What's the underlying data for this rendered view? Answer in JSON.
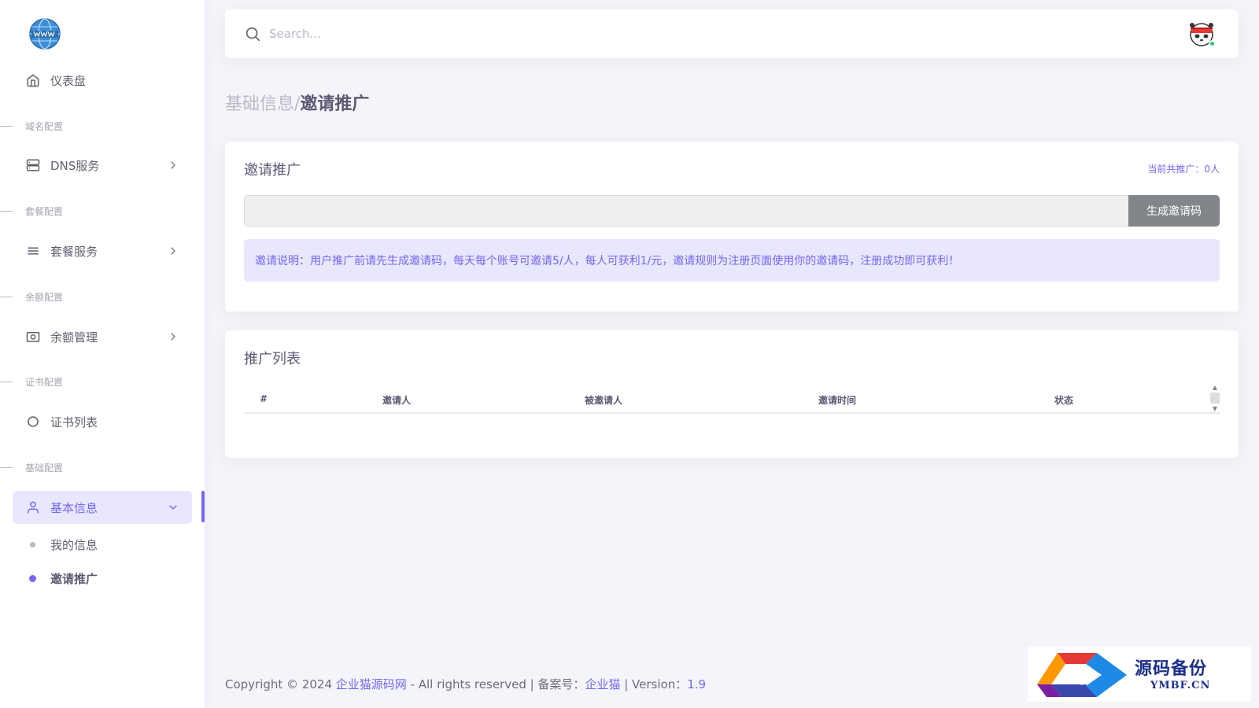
{
  "sidebar": {
    "dashboard": "仪表盘",
    "sections": [
      {
        "header": "域名配置",
        "item": "DNS服务"
      },
      {
        "header": "套餐配置",
        "item": "套餐服务"
      },
      {
        "header": "余额配置",
        "item": "余额管理"
      },
      {
        "header": "证书配置",
        "item": "证书列表"
      },
      {
        "header": "基础配置",
        "item": "基本信息"
      }
    ],
    "sub_items": [
      "我的信息",
      "邀请推广"
    ]
  },
  "topbar": {
    "search_placeholder": "Search..."
  },
  "breadcrumb": {
    "parent": "基础信息/",
    "current": "邀请推广"
  },
  "invite_card": {
    "title": "邀请推广",
    "count_label": "当前共推广：0人",
    "generate_button": "生成邀请码",
    "notice": "邀请说明：用户推广前请先生成邀请码，每天每个账号可邀请5/人，每人可获利1/元，邀请规则为注册页面使用你的邀请码，注册成功即可获利！"
  },
  "list_card": {
    "title": "推广列表",
    "columns": [
      "#",
      "邀请人",
      "被邀请人",
      "邀请时间",
      "状态"
    ]
  },
  "footer": {
    "prefix": "Copyright © 2024 ",
    "site": "企业猫源码网",
    "rights": " - All rights reserved | 备案号：",
    "icp": "企业猫",
    "version_label": " | Version：",
    "version": "1.9"
  },
  "watermark": {
    "logo_char": "码",
    "title": "源码备份",
    "domain": "YMBF.CN"
  },
  "colors": {
    "primary": "#7367f0",
    "primary_light": "#e8e7fd",
    "secondary": "#82868b",
    "online": "#28c76f"
  }
}
